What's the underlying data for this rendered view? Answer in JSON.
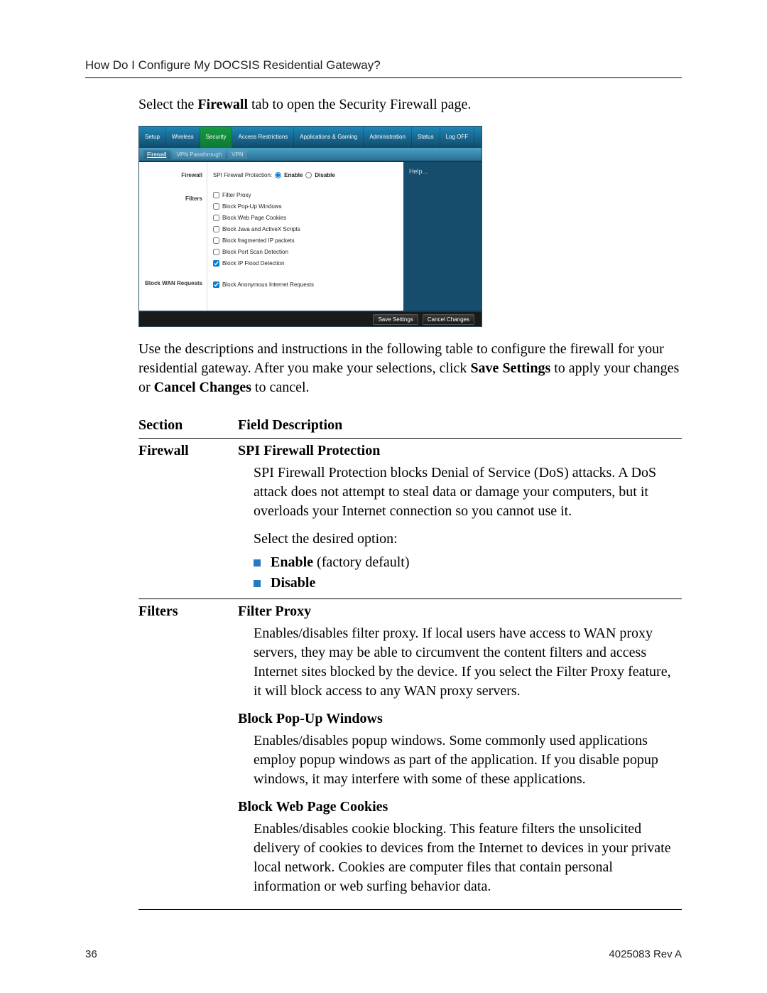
{
  "header": "How Do I Configure My DOCSIS Residential Gateway?",
  "intro_pre": "Select the ",
  "intro_b": "Firewall",
  "intro_post": " tab to open the Security Firewall page.",
  "nav": {
    "tabs": [
      {
        "label": "Setup"
      },
      {
        "label": "Wireless"
      },
      {
        "label": "Security"
      },
      {
        "label": "Access Restrictions"
      },
      {
        "label": "Applications & Gaming"
      },
      {
        "label": "Administration"
      },
      {
        "label": "Status"
      },
      {
        "label": "Log OFF"
      }
    ],
    "subtabs": [
      {
        "label": "Firewall"
      },
      {
        "label": "VPN Passthrough"
      },
      {
        "label": "VPN"
      }
    ]
  },
  "router": {
    "left1": "Firewall",
    "left2": "Filters",
    "left3": "Block WAN Requests",
    "spi_label": "SPI Firewall Protection:",
    "enable": "Enable",
    "disable": "Disable",
    "filters": [
      "Filter Proxy",
      "Block Pop-Up Windows",
      "Block Web Page Cookies",
      "Block Java and ActiveX Scripts",
      "Block fragmented IP packets",
      "Block Port Scan Detection",
      "Block IP Flood Detection"
    ],
    "wan_item": "Block Anonymous Internet Requests",
    "help": "Help...",
    "save": "Save Settings",
    "cancel": "Cancel Changes"
  },
  "body1": "Use the descriptions and instructions in the following table to configure the firewall for your residential gateway. After you make your selections, click ",
  "body1_b1": "Save Settings",
  "body1_mid": " to apply your changes or ",
  "body1_b2": "Cancel Changes",
  "body1_end": " to cancel.",
  "table": {
    "h1": "Section",
    "h2": "Field Description",
    "r1_sec": "Firewall",
    "r1": {
      "title": "SPI Firewall Protection",
      "p1": "SPI Firewall Protection blocks Denial of Service (DoS) attacks. A DoS attack does not attempt to steal data or damage your computers, but it overloads your Internet connection so you cannot use it.",
      "p2": "Select the desired option:",
      "b1_b": "Enable",
      "b1_rest": " (factory default)",
      "b2_b": "Disable"
    },
    "r2_sec": "Filters",
    "r2a": {
      "title": "Filter Proxy",
      "p": "Enables/disables filter proxy. If local users have access to WAN proxy servers, they may be able to circumvent the content filters and access Internet sites blocked by the device. If you select the Filter Proxy feature, it will block access to any WAN proxy servers."
    },
    "r2b": {
      "title": "Block Pop-Up Windows",
      "p": "Enables/disables popup windows. Some commonly used applications employ popup windows as part of the application. If you disable popup windows, it may interfere with some of these applications."
    },
    "r2c": {
      "title": "Block Web Page Cookies",
      "p": "Enables/disables cookie blocking. This feature filters the unsolicited delivery of cookies to devices from the Internet to devices in your private local network. Cookies are computer files that contain personal information or web surfing behavior data."
    }
  },
  "footer": {
    "page": "36",
    "rev": "4025083 Rev A"
  }
}
